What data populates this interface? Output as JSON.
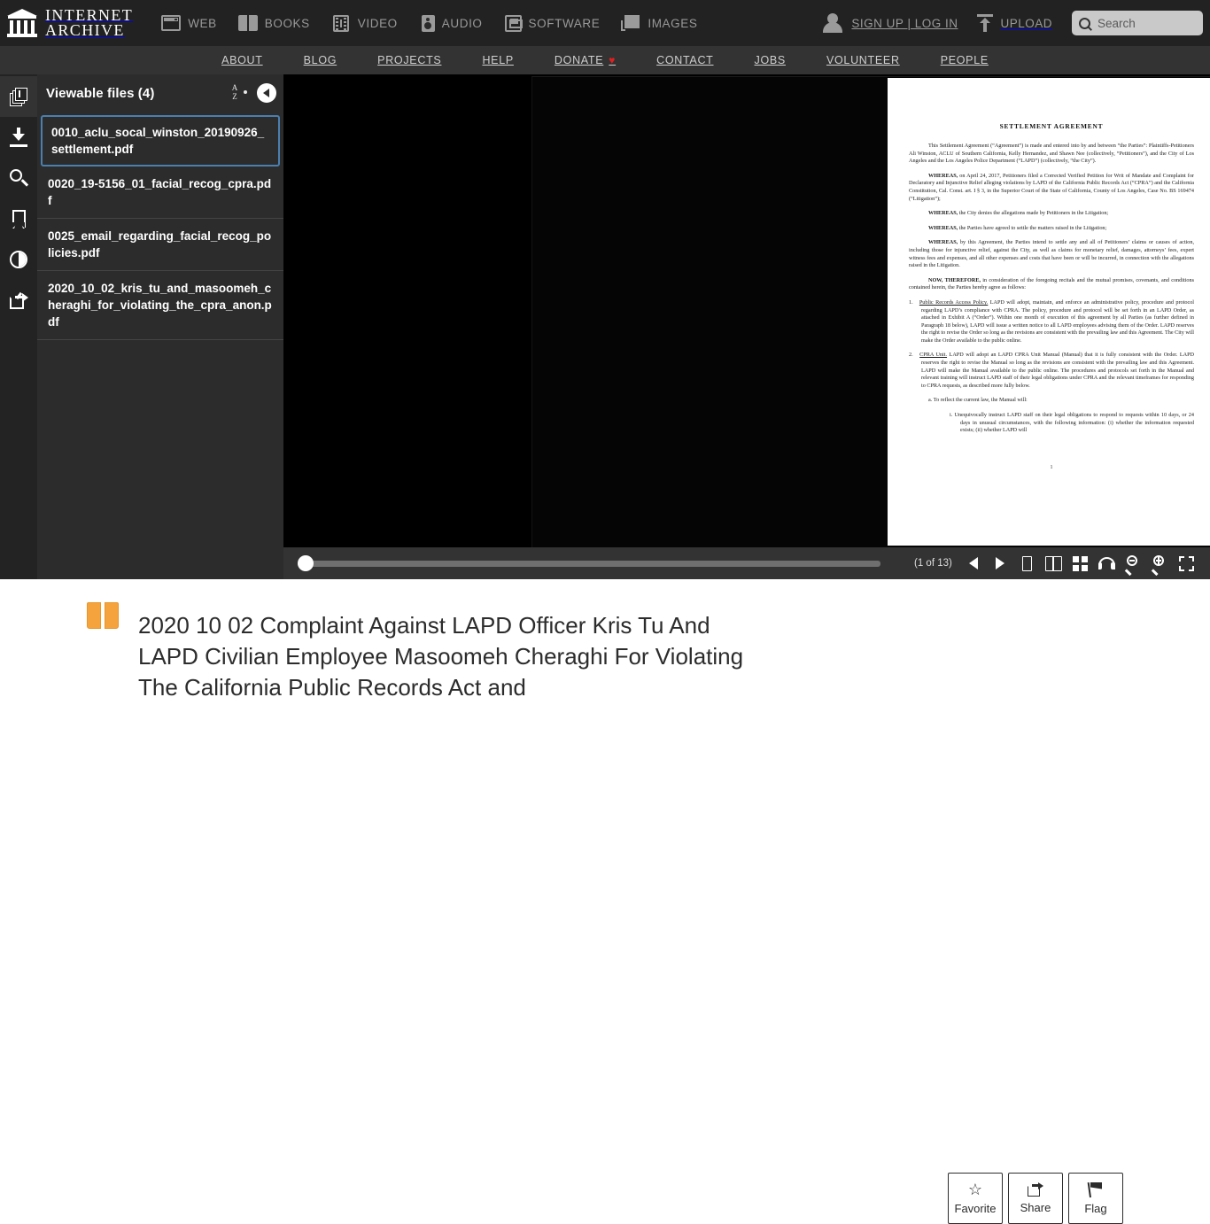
{
  "header": {
    "logo_line1": "INTERNET",
    "logo_line2": "ARCHIVE",
    "media_nav": [
      {
        "label": "WEB",
        "icon": "web-icon"
      },
      {
        "label": "BOOKS",
        "icon": "books-icon"
      },
      {
        "label": "VIDEO",
        "icon": "video-icon"
      },
      {
        "label": "AUDIO",
        "icon": "audio-icon"
      },
      {
        "label": "SOFTWARE",
        "icon": "software-icon"
      },
      {
        "label": "IMAGES",
        "icon": "images-icon"
      }
    ],
    "signup_login": "SIGN UP | LOG IN",
    "upload": "UPLOAD",
    "search_placeholder": "Search"
  },
  "subnav": {
    "items": [
      {
        "label": "ABOUT"
      },
      {
        "label": "BLOG"
      },
      {
        "label": "PROJECTS"
      },
      {
        "label": "HELP"
      },
      {
        "label": "DONATE",
        "heart": "♥"
      },
      {
        "label": "CONTACT"
      },
      {
        "label": "JOBS"
      },
      {
        "label": "VOLUNTEER"
      },
      {
        "label": "PEOPLE"
      }
    ]
  },
  "sidebar": {
    "title": "Viewable files (4)",
    "files": [
      {
        "name": "0010_aclu_socal_winston_20190926_settlement.pdf",
        "selected": true
      },
      {
        "name": "0020_19-5156_01_facial_recog_cpra.pdf",
        "selected": false
      },
      {
        "name": "0025_email_regarding_facial_recog_policies.pdf",
        "selected": false
      },
      {
        "name": "2020_10_02_kris_tu_and_masoomeh_cheraghi_for_violating_the_cpra_anon.pdf",
        "selected": false
      }
    ]
  },
  "rail": {
    "items": [
      {
        "icon": "files-icon",
        "name": "viewable-files",
        "active": true
      },
      {
        "icon": "download-icon",
        "name": "download",
        "active": false
      },
      {
        "icon": "search-icon",
        "name": "search-inside",
        "active": false
      },
      {
        "icon": "bookmark-icon",
        "name": "bookmarks",
        "active": false
      },
      {
        "icon": "contrast-icon",
        "name": "visual-adjustments",
        "active": false
      },
      {
        "icon": "share-icon",
        "name": "share",
        "active": false
      }
    ]
  },
  "document": {
    "title": "SETTLEMENT AGREEMENT",
    "page_number": "1",
    "paragraphs": [
      {
        "indent": true,
        "text": "This Settlement Agreement (“Agreement”) is made and entered into by and between “the Parties”: Plaintiffs-Petitioners Ali Winston, ACLU of Southern California, Kelly Hernandez, and Shawn Nee (collectively, “Petitioners”), and the City of Los Angeles and the Los Angeles Police Department (“LAPD”) (collectively, “the City”)."
      },
      {
        "indent": true,
        "lead": "WHEREAS,",
        "text": " on April 24, 2017, Petitioners filed a Corrected Verified Petition for Writ of Mandate and Complaint for Declaratory and Injunctive Relief alleging violations by LAPD of the California Public Records Act (“CPRA”) and the California Constitution, Cal. Const. art. I § 3, in the Superior Court of the State of California, County of Los Angeles, Case No. BS 169474 (“Litigation”);"
      },
      {
        "indent": true,
        "lead": "WHEREAS,",
        "text": " the City denies the allegations made by Petitioners in the Litigation;"
      },
      {
        "indent": true,
        "lead": "WHEREAS,",
        "text": " the Parties have agreed to settle the matters raised in the Litigation;"
      },
      {
        "indent": true,
        "lead": "WHEREAS,",
        "text": " by this Agreement, the Parties intend to settle any and all of Petitioners’ claims or causes of action, including those for injunctive relief, against the City, as well as claims for monetary relief, damages, attorneys’ fees, expert witness fees and expenses, and all other expenses and costs that have been or will be incurred, in connection with the allegations raised in the Litigation."
      },
      {
        "indent": true,
        "lead": "NOW, THEREFORE,",
        "text": " in consideration of the foregoing recitals and the mutual promises, covenants, and conditions contained herein, the Parties hereby agree as follows:"
      }
    ],
    "numbered_items": [
      {
        "number": "1.",
        "heading": "Public Records Access Policy.",
        "text": "  LAPD will adopt, maintain, and enforce an administrative policy, procedure and protocol regarding LAPD’s compliance with CPRA.  The policy, procedure and protocol will be set forth in an LAPD Order, as attached in Exhibit A (“Order”).  Within one month of execution of this agreement by all Parties (as further defined in Paragraph 18 below), LAPD will issue a written notice to all LAPD employees advising them of the Order.  LAPD reserves the right to revise the Order so long as the revisions are consistent with the prevailing law and this Agreement. The City will make the Order available to the public online."
      },
      {
        "number": "2.",
        "heading": "CPRA Unit.",
        "text": "  LAPD will adopt an LAPD CPRA Unit Manual (Manual) that it is fully consistent with the Order.  LAPD reserves the right to revise the Manual so long as the revisions are consistent with the prevailing law and this Agreement.  LAPD will make the Manual available to the public online. The procedures and protocols set forth in the Manual and relevant training will instruct LAPD staff of their legal obligations under CPRA and the relevant timeframes for responding to CPRA requests, as described more fully below."
      }
    ],
    "sub_a": "a.   To reflect the current law, the Manual will:",
    "sub_i": "i.   Unequivocally instruct LAPD staff on their legal obligations to respond to requests within 10 days, or 24 days in unusual circumstances, with the following information: (i) whether the information requested exists; (ii) whether LAPD will"
  },
  "readerbar": {
    "page_count": "(1 of 13)",
    "controls": [
      {
        "name": "previous-page-button",
        "icon": "triangle-left-icon"
      },
      {
        "name": "next-page-button",
        "icon": "triangle-right-icon"
      },
      {
        "name": "one-page-view-button",
        "icon": "one-page-icon"
      },
      {
        "name": "two-page-view-button",
        "icon": "two-page-icon"
      },
      {
        "name": "thumbnail-view-button",
        "icon": "grid-icon"
      },
      {
        "name": "read-aloud-button",
        "icon": "headphones-icon"
      },
      {
        "name": "zoom-out-button",
        "icon": "zoom-out-icon"
      },
      {
        "name": "zoom-in-button",
        "icon": "zoom-in-icon"
      },
      {
        "name": "fullscreen-button",
        "icon": "fullscreen-icon"
      }
    ]
  },
  "footer": {
    "item_title": "2020 10 02 Complaint Against LAPD Officer Kris Tu And LAPD Civilian Employee Masoomeh Cheraghi For Violating The California Public Records Act and",
    "actions": [
      {
        "label": "Favorite",
        "icon": "star-icon"
      },
      {
        "label": "Share",
        "icon": "share-icon"
      },
      {
        "label": "Flag",
        "icon": "flag-icon"
      }
    ]
  },
  "colors": {
    "header_bg": "#222222",
    "subnav_bg": "#333333",
    "sidebar_bg": "#2c2c2c",
    "rail_bg": "#232323",
    "stage_bg": "#000000",
    "selected_border": "#4a7fae",
    "donate_heart": "#e02020",
    "book_orange": "#f5a33c"
  }
}
